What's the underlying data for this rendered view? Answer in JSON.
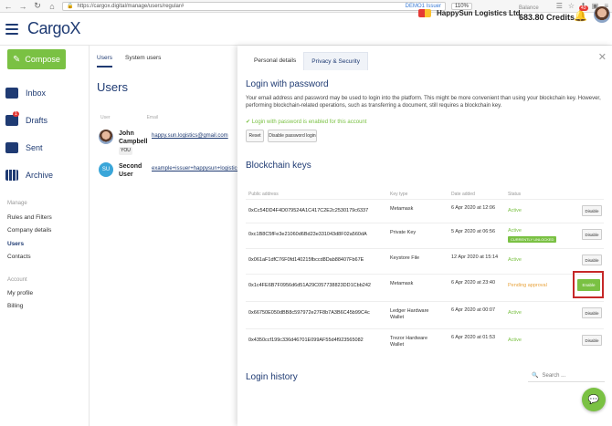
{
  "browser": {
    "url": "https://cargox.digital/manage/users/regular#",
    "tag": "DEMO1 Issuer",
    "zoom": "110%"
  },
  "header": {
    "logo_main": "CargoX",
    "company": "HappySun Logistics Ltd.",
    "balance_label": "Balance",
    "balance_value": "683.80 Credits",
    "notif_count": "43"
  },
  "sidebar": {
    "compose": "Compose",
    "inbox": "Inbox",
    "drafts": "Drafts",
    "drafts_count": "1",
    "sent": "Sent",
    "archive": "Archive",
    "manage_title": "Manage",
    "manage_items": [
      "Rules and Filters",
      "Company details",
      "Users",
      "Contacts"
    ],
    "account_title": "Account",
    "account_items": [
      "My profile",
      "Billing"
    ]
  },
  "users": {
    "tabs": [
      "Users",
      "System users"
    ],
    "title": "Users",
    "col_user": "User",
    "col_email": "Email",
    "rows": [
      {
        "name": "John Campbell",
        "you": "YOU",
        "email": "happy.sun.logistics@gmail.com"
      },
      {
        "initials": "SU",
        "name": "Second User",
        "email": "example+issuer+happysun+logistics"
      }
    ]
  },
  "panel": {
    "tabs": [
      "Personal details",
      "Privacy & Security"
    ],
    "login_title": "Login with password",
    "login_desc": "Your email address and password may be used to login into the platform. This might be more convenient than using your blockchain key. However, performing blockchain-related operations, such as transferring a document, still requires a blockchain key.",
    "login_ok": "✔ Login with password is enabled for this account",
    "reset": "Reset",
    "disable_pw": "Disable password login",
    "keys_title": "Blockchain keys",
    "cols": [
      "Public address",
      "Key type",
      "Date added",
      "Status"
    ],
    "keys": [
      {
        "addr": "0xCc54DD4F4D079524A1C417C2E2c2530179c6337",
        "type": "Metamask",
        "date": "6 Apr 2020 at 12:06",
        "date2": "",
        "status": "Active",
        "unlock": "",
        "action": "Disable"
      },
      {
        "addr": "0xc1B8C5fFe3e21060d6Bd23e331043d8F02a560dA",
        "type": "Private Key",
        "date": "5 Apr 2020 at 06:56",
        "date2": "",
        "status": "Active",
        "unlock": "CURRENTLY UNLOCKED",
        "action": "Disable"
      },
      {
        "addr": "0x061aF1dfC76F0fd140215fbccd8Dab88407Fb67E",
        "type": "Keystore File",
        "date": "12 Apr 2020 at 15:14",
        "date2": "",
        "status": "Active",
        "unlock": "",
        "action": "Disable"
      },
      {
        "addr": "0x1c4FE6B7F0956d6d51A29C057738823DD1Cbb242",
        "type": "Metamask",
        "date": "6 Apr 2020 at 23:40",
        "date2": "",
        "status": "Pending approval",
        "unlock": "",
        "action": "Enable"
      },
      {
        "addr": "0x66750E050dBB8c597972e27F8b7A3B6C45b99C4c",
        "type": "Ledger Hardware Wallet",
        "date": "6 Apr 2020 at 00:07",
        "date2": "",
        "status": "Active",
        "unlock": "",
        "action": "Disable"
      },
      {
        "addr": "0x4350ccf199c336d46701E099AF55d4f923565082",
        "type": "Trezor Hardware Wallet",
        "date": "6 Apr 2020 at 01:53",
        "date2": "",
        "status": "Active",
        "unlock": "",
        "action": "Disable"
      }
    ],
    "history_title": "Login history",
    "search_placeholder": "Search ..."
  }
}
